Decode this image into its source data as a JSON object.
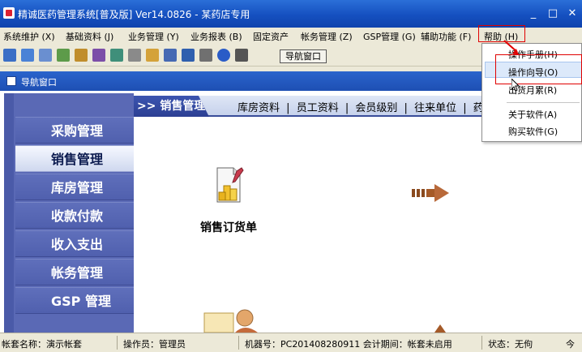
{
  "window": {
    "title": "精诚医药管理系统[普及版] Ver14.0826 - 某药店专用",
    "minimize": "_",
    "maximize": "□",
    "close": "✕"
  },
  "menu": {
    "items": [
      "系统维护 (X)",
      "基础资料 (J)",
      "业务管理 (Y)",
      "业务报表 (B)",
      "固定资产",
      "帐务管理 (Z)",
      "GSP管理 (G)",
      "辅助功能 (F)",
      "帮助 (H)"
    ]
  },
  "toolbar": {
    "nav_button": "导航窗口"
  },
  "nav_window": {
    "title": "导航窗口"
  },
  "sidebar": {
    "items": [
      "采购管理",
      "销售管理",
      "库房管理",
      "收款付款",
      "收入支出",
      "帐务管理",
      "GSP 管理"
    ]
  },
  "content": {
    "section_title": ">> 销售管理",
    "sub_nav": [
      "库房资料",
      "|",
      "员工资料",
      "|",
      "会员级别",
      "|",
      "往来单位",
      "|",
      "药"
    ],
    "doc_label": "销售订货单"
  },
  "help_menu": {
    "items": [
      "操作手册(H)",
      "操作向导(O)",
      "出货月累(R)",
      "关于软件(A)",
      "购买软件(G)"
    ]
  },
  "statusbar": {
    "account": "帐套名称：演示帐套",
    "operator": "操作员：管理员",
    "machine": "机器号：PC201408280911 会计期间：帐套未启用",
    "state": "状态：无佝",
    "extra": "今"
  },
  "colors": {
    "title_blue": "#1550c0",
    "sidebar_blue": "#5a69b5",
    "highlight_red": "#e00000"
  }
}
